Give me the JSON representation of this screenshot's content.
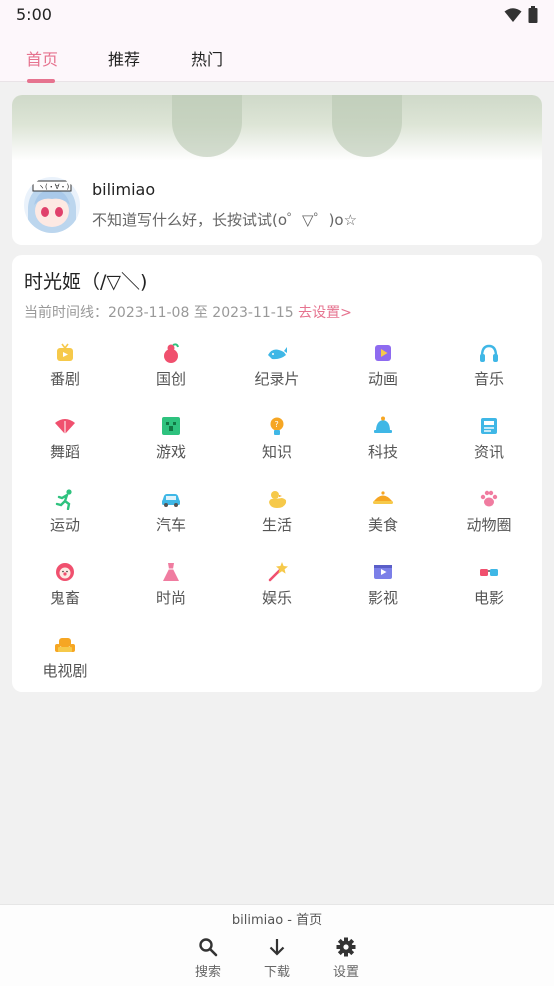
{
  "status_bar": {
    "time": "5:00",
    "wifi_icon": "wifi-icon",
    "battery_icon": "battery-icon"
  },
  "tabs": [
    {
      "label": "首页",
      "active": true
    },
    {
      "label": "推荐",
      "active": false
    },
    {
      "label": "热门",
      "active": false
    }
  ],
  "user": {
    "name": "bilimiao",
    "signature": "不知道写什么好，长按试试(o゜▽゜)o☆"
  },
  "timeline": {
    "title": "时光姬（/▽＼)",
    "range_prefix": "当前时间线：",
    "start": "2023-11-08",
    "sep": " 至 ",
    "end": "2023-11-15",
    "link": "去设置>"
  },
  "categories": [
    {
      "label": "番剧",
      "icon": "tv-icon",
      "color": "#f6c94a"
    },
    {
      "label": "国创",
      "icon": "gourd-icon",
      "color": "#f0506e"
    },
    {
      "label": "纪录片",
      "icon": "whale-icon",
      "color": "#3fb7e6"
    },
    {
      "label": "动画",
      "icon": "play-icon",
      "color": "#8e6bf0"
    },
    {
      "label": "音乐",
      "icon": "headphone-icon",
      "color": "#3fb7e6"
    },
    {
      "label": "舞蹈",
      "icon": "fan-icon",
      "color": "#f0506e"
    },
    {
      "label": "游戏",
      "icon": "creeper-icon",
      "color": "#2ec27e"
    },
    {
      "label": "知识",
      "icon": "lightbulb-icon",
      "color": "#f6a623"
    },
    {
      "label": "科技",
      "icon": "bell-icon",
      "color": "#3fb7e6"
    },
    {
      "label": "资讯",
      "icon": "news-icon",
      "color": "#3fb7e6"
    },
    {
      "label": "运动",
      "icon": "runner-icon",
      "color": "#2ec27e"
    },
    {
      "label": "汽车",
      "icon": "car-icon",
      "color": "#3fb7e6"
    },
    {
      "label": "生活",
      "icon": "duck-icon",
      "color": "#f6c94a"
    },
    {
      "label": "美食",
      "icon": "dish-icon",
      "color": "#f6a623"
    },
    {
      "label": "动物圈",
      "icon": "paw-icon",
      "color": "#f07ca0"
    },
    {
      "label": "鬼畜",
      "icon": "clown-icon",
      "color": "#f0506e"
    },
    {
      "label": "时尚",
      "icon": "dress-icon",
      "color": "#f07ca0"
    },
    {
      "label": "娱乐",
      "icon": "wand-icon",
      "color": "#f0506e"
    },
    {
      "label": "影视",
      "icon": "film-icon",
      "color": "#7b7fe8"
    },
    {
      "label": "电影",
      "icon": "3d-glasses-icon",
      "color": "#3fb7e6"
    },
    {
      "label": "电视剧",
      "icon": "sofa-icon",
      "color": "#f6a623"
    }
  ],
  "bottom": {
    "title": "bilimiao - 首页",
    "items": [
      {
        "label": "搜索",
        "icon": "search-icon"
      },
      {
        "label": "下载",
        "icon": "download-icon"
      },
      {
        "label": "设置",
        "icon": "settings-icon"
      }
    ]
  },
  "colors": {
    "accent": "#e6738f",
    "background": "#f1f1f1",
    "card": "#ffffff"
  }
}
